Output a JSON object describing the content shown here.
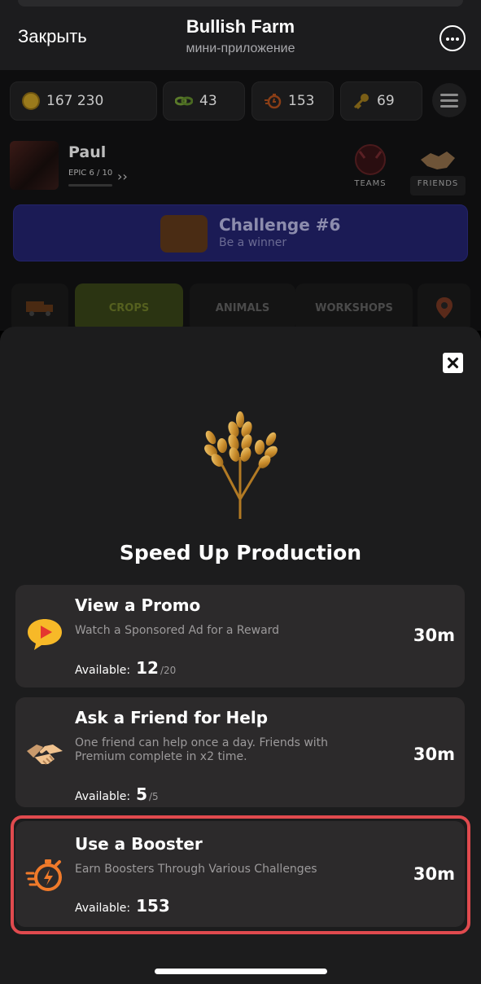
{
  "telegram_bar": {
    "close_label": "Закрыть",
    "title": "Bullish Farm",
    "subtitle": "мини-приложение",
    "more_icon": "more-options-icon"
  },
  "resources": {
    "coins": "167 230",
    "links": "43",
    "boosters": "153",
    "keys": "69"
  },
  "player": {
    "name": "Paul",
    "rank": "EPIC 6 / 10"
  },
  "side_buttons": {
    "teams": "TEAMS",
    "friends": "FRIENDS"
  },
  "challenge": {
    "title": "Challenge #6",
    "subtitle": "Be a winner"
  },
  "tabs": {
    "crops": "CROPS",
    "animals": "ANIMALS",
    "workshops": "WORKSHOPS"
  },
  "sheet": {
    "title": "Speed Up Production",
    "options": [
      {
        "title": "View a Promo",
        "description": "Watch a Sponsored Ad for a Reward",
        "available_label": "Available:",
        "available": "12",
        "max": "/20",
        "time": "30m"
      },
      {
        "title": "Ask a Friend for Help",
        "description": "One friend can help once a day. Friends with Premium complete in x2 time.",
        "available_label": "Available:",
        "available": "5",
        "max": "/5",
        "time": "30m"
      },
      {
        "title": "Use a Booster",
        "description": "Earn Boosters Through Various Challenges",
        "available_label": "Available:",
        "available": "153",
        "time": "30m"
      }
    ]
  },
  "colors": {
    "sheet_bg": "#1c1c1d",
    "card_bg": "#2c2a2b",
    "highlight": "#e04a4e",
    "accent_orange": "#f07a2a",
    "gold": "#d9a441"
  }
}
